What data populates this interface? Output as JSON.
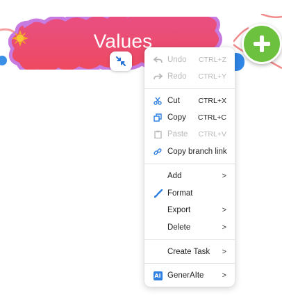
{
  "node": {
    "title": "Values",
    "icon": "sun-star-icon",
    "fill_color": "#ea4f7a",
    "border_color": "#c77be0"
  },
  "add_button": {
    "icon": "plus-icon",
    "color": "#6cc23f"
  },
  "collapse_button": {
    "icon": "collapse-arrows-icon"
  },
  "menu": {
    "undo": {
      "label": "Undo",
      "shortcut": "CTRL+Z"
    },
    "redo": {
      "label": "Redo",
      "shortcut": "CTRL+Y"
    },
    "cut": {
      "label": "Cut",
      "shortcut": "CTRL+X"
    },
    "copy": {
      "label": "Copy",
      "shortcut": "CTRL+C"
    },
    "paste": {
      "label": "Paste",
      "shortcut": "CTRL+V"
    },
    "copy_branch_link": {
      "label": "Copy branch link"
    },
    "add": {
      "label": "Add",
      "arrow": ">"
    },
    "format": {
      "label": "Format"
    },
    "export": {
      "label": "Export",
      "arrow": ">"
    },
    "delete": {
      "label": "Delete",
      "arrow": ">"
    },
    "create_task": {
      "label": "Create Task",
      "arrow": ">"
    },
    "generaite": {
      "label": "GenerAIte",
      "badge": "AI",
      "arrow": ">"
    }
  }
}
